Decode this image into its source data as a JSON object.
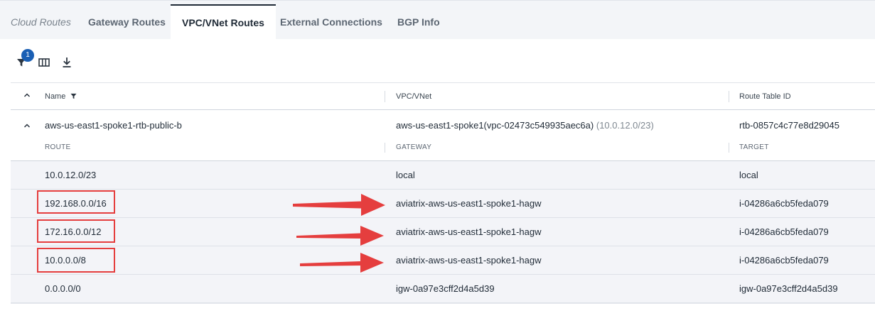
{
  "tabs": [
    {
      "label": "Cloud Routes"
    },
    {
      "label": "Gateway Routes"
    },
    {
      "label": "VPC/VNet Routes"
    },
    {
      "label": "External Connections"
    },
    {
      "label": "BGP Info"
    }
  ],
  "toolbar": {
    "filter_badge": "1",
    "icons": [
      "filter-icon",
      "columns-icon",
      "download-icon"
    ]
  },
  "table": {
    "headers": {
      "name": "Name",
      "vpc": "VPC/VNet",
      "route_table": "Route Table ID"
    },
    "group": {
      "name": "aws-us-east1-spoke1-rtb-public-b",
      "vpc": "aws-us-east1-spoke1(vpc-02473c549935aec6a)",
      "vpc_cidr": "(10.0.12.0/23)",
      "route_table": "rtb-0857c4c77e8d29045",
      "sub_headers": {
        "route": "ROUTE",
        "gateway": "GATEWAY",
        "target": "TARGET"
      }
    },
    "rows": [
      {
        "route": "10.0.12.0/23",
        "gateway": "local",
        "target": "local"
      },
      {
        "route": "192.168.0.0/16",
        "gateway": "aviatrix-aws-us-east1-spoke1-hagw",
        "target": "i-04286a6cb5feda079"
      },
      {
        "route": "172.16.0.0/12",
        "gateway": "aviatrix-aws-us-east1-spoke1-hagw",
        "target": "i-04286a6cb5feda079"
      },
      {
        "route": "10.0.0.0/8",
        "gateway": "aviatrix-aws-us-east1-spoke1-hagw",
        "target": "i-04286a6cb5feda079"
      },
      {
        "route": "0.0.0.0/0",
        "gateway": "igw-0a97e3cff2d4a5d39",
        "target": "igw-0a97e3cff2d4a5d39"
      }
    ]
  },
  "annotations": {
    "highlight_color": "#e53e3e"
  }
}
